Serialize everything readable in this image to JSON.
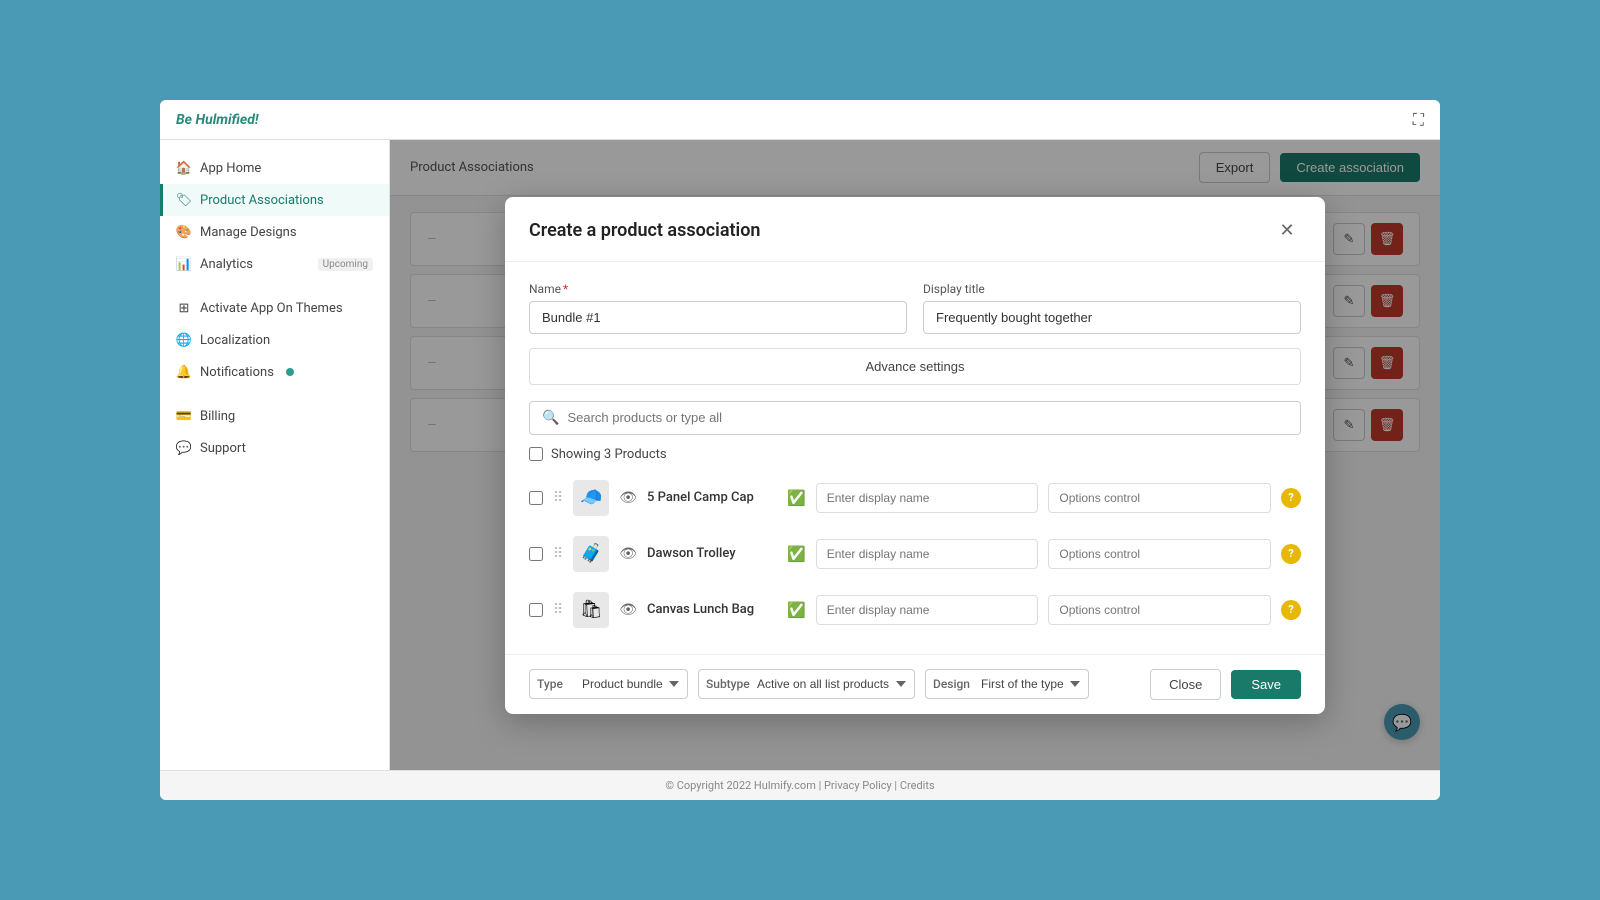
{
  "app": {
    "title_be": "Be",
    "title_name": "Hulmified!",
    "fullscreen_icon": "⛶"
  },
  "sidebar": {
    "items": [
      {
        "id": "app-home",
        "label": "App Home",
        "icon": "🏠",
        "active": false
      },
      {
        "id": "product-associations",
        "label": "Product Associations",
        "icon": "🏷",
        "active": true
      },
      {
        "id": "manage-designs",
        "label": "Manage Designs",
        "icon": "🎨",
        "active": false
      },
      {
        "id": "analytics",
        "label": "Analytics",
        "icon": "📊",
        "active": false,
        "tag": "Upcoming"
      },
      {
        "id": "activate-app",
        "label": "Activate App On Themes",
        "icon": "⊞",
        "active": false
      },
      {
        "id": "localization",
        "label": "Localization",
        "icon": "🌐",
        "active": false
      },
      {
        "id": "notifications",
        "label": "Notifications",
        "icon": "🔔",
        "active": false,
        "badge": true
      },
      {
        "id": "billing",
        "label": "Billing",
        "icon": "💳",
        "active": false
      },
      {
        "id": "support",
        "label": "Support",
        "icon": "💬",
        "active": false
      }
    ]
  },
  "main": {
    "breadcrumb": "Product Associations",
    "export_label": "Export",
    "create_label": "Create association",
    "table_rows": [
      {
        "id": "row1"
      },
      {
        "id": "row2"
      },
      {
        "id": "row3"
      },
      {
        "id": "row4"
      }
    ]
  },
  "modal": {
    "title": "Create a product association",
    "name_label": "Name",
    "name_required": "*",
    "name_value": "Bundle #1",
    "display_title_label": "Display title",
    "display_title_value": "Frequently bought together",
    "advance_settings_label": "Advance settings",
    "search_placeholder": "Search products or type all",
    "showing_label": "Showing 3 Products",
    "products": [
      {
        "id": "prod1",
        "name": "5 Panel Camp Cap",
        "thumb_emoji": "🧢",
        "display_name_placeholder": "Enter display name",
        "options_placeholder": "Options control"
      },
      {
        "id": "prod2",
        "name": "Dawson Trolley",
        "thumb_emoji": "🧳",
        "display_name_placeholder": "Enter display name",
        "options_placeholder": "Options control"
      },
      {
        "id": "prod3",
        "name": "Canvas Lunch Bag",
        "thumb_emoji": "🛍",
        "display_name_placeholder": "Enter display name",
        "options_placeholder": "Options control"
      }
    ],
    "footer": {
      "type_label": "Type",
      "type_value": "Product bundle",
      "subtype_label": "Subtype",
      "subtype_value": "Active on all list products",
      "design_label": "Design",
      "design_value": "First of the type",
      "close_label": "Close",
      "save_label": "Save"
    }
  },
  "footer": {
    "copyright": "© Copyright 2022 Hulmify.com | Privacy Policy | Credits"
  }
}
